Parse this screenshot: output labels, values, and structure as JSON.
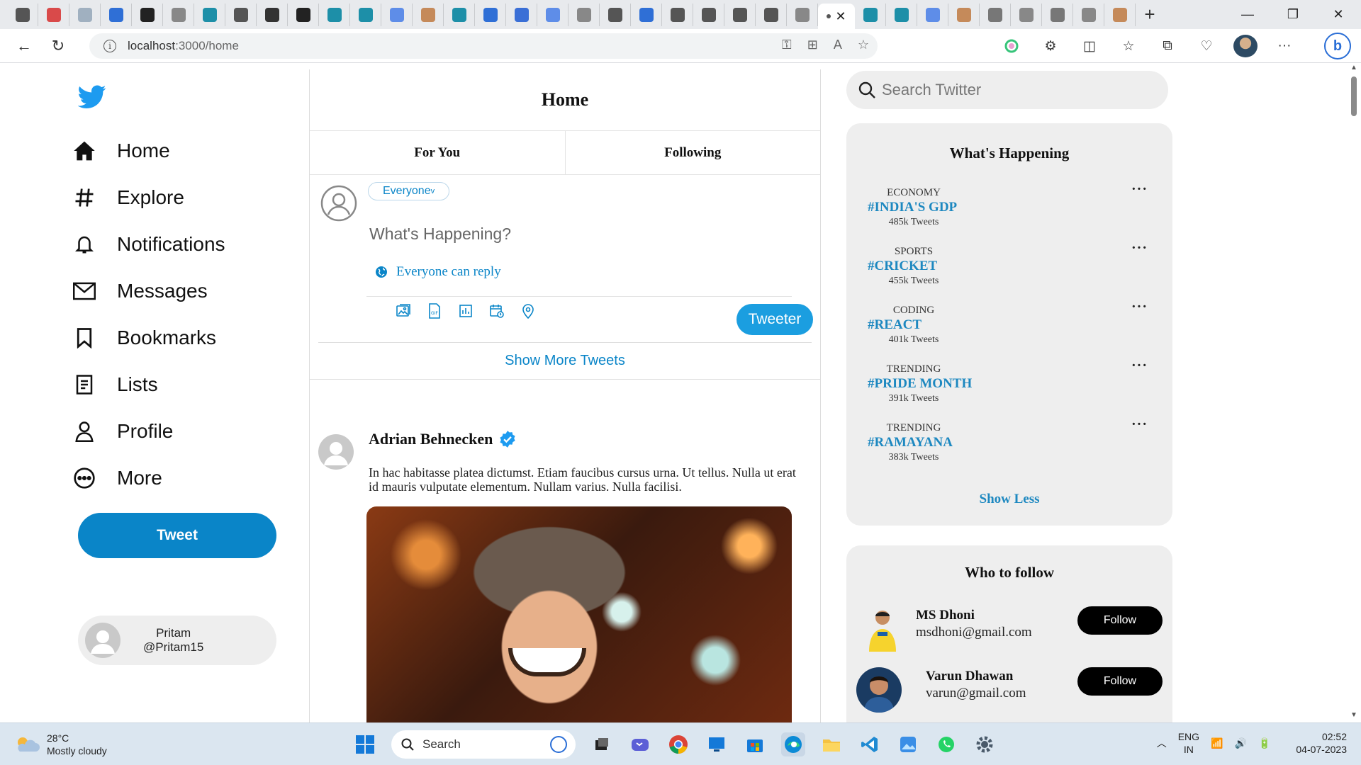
{
  "browser": {
    "url_host": "localhost",
    "url_path": ":3000/home",
    "tab_count": 36
  },
  "sidebar": {
    "items": [
      {
        "label": "Home",
        "icon": "home-icon"
      },
      {
        "label": "Explore",
        "icon": "hashtag-icon"
      },
      {
        "label": "Notifications",
        "icon": "bell-icon"
      },
      {
        "label": "Messages",
        "icon": "mail-icon"
      },
      {
        "label": "Bookmarks",
        "icon": "bookmark-icon"
      },
      {
        "label": "Lists",
        "icon": "list-icon"
      },
      {
        "label": "Profile",
        "icon": "person-icon"
      },
      {
        "label": "More",
        "icon": "more-circle-icon"
      }
    ],
    "tweet_label": "Tweet",
    "user": {
      "name": "Pritam",
      "handle": "@Pritam15"
    }
  },
  "main": {
    "title": "Home",
    "tabs": [
      {
        "label": "For You"
      },
      {
        "label": "Following"
      }
    ],
    "composer": {
      "audience": "Everyone",
      "audience_marker": "v",
      "placeholder": "What's Happening?",
      "reply_setting": "Everyone can reply",
      "submit_label": "Tweeter",
      "tools": [
        "image-icon",
        "gif-icon",
        "poll-icon",
        "schedule-icon",
        "location-icon"
      ]
    },
    "show_more": "Show More Tweets",
    "post": {
      "author": "Adrian Behnecken",
      "verified": true,
      "text": "In hac habitasse platea dictumst. Etiam faucibus cursus urna. Ut tellus. Nulla ut erat id mauris vulputate elementum. Nullam varius. Nulla facilisi."
    }
  },
  "right": {
    "search_placeholder": "Search Twitter",
    "trends_title": "What's Happening",
    "trends": [
      {
        "category": "ECONOMY",
        "tag": "#INDIA'S GDP",
        "count": "485k Tweets"
      },
      {
        "category": "SPORTS",
        "tag": "#CRICKET",
        "count": "455k Tweets"
      },
      {
        "category": "CODING",
        "tag": "#REACT",
        "count": "401k Tweets"
      },
      {
        "category": "TRENDING",
        "tag": "#PRIDE MONTH",
        "count": "391k Tweets"
      },
      {
        "category": "TRENDING",
        "tag": "#RAMAYANA",
        "count": "383k Tweets"
      }
    ],
    "show_less": "Show Less",
    "follow_title": "Who to follow",
    "follow": [
      {
        "name": "MS Dhoni",
        "email": "msdhoni@gmail.com",
        "button": "Follow"
      },
      {
        "name": "Varun Dhawan",
        "email": "varun@gmail.com",
        "button": "Follow"
      }
    ]
  },
  "taskbar": {
    "weather_temp": "28°C",
    "weather_desc": "Mostly cloudy",
    "search_label": "Search",
    "lang_top": "ENG",
    "lang_bottom": "IN",
    "time": "02:52",
    "date": "04-07-2023"
  },
  "colors": {
    "accent": "#0a85c8",
    "twitter_blue": "#1d9bf0",
    "trend_link": "#1d88c0",
    "card_bg": "#eeeeee"
  }
}
